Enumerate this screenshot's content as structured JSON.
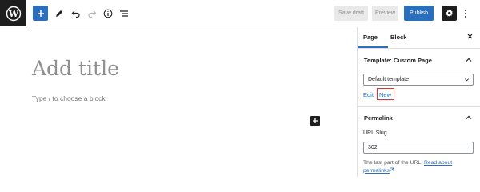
{
  "toolbar": {
    "logo_icon": "wordpress-logo",
    "add_block_icon": "plus-icon",
    "tools_icon": "pencil-icon",
    "undo_icon": "undo-icon",
    "redo_icon": "redo-icon",
    "info_icon": "info-icon",
    "list_view_icon": "list-view-icon",
    "save_draft_label": "Save draft",
    "preview_label": "Preview",
    "publish_label": "Publish",
    "settings_icon": "gear-icon",
    "more_icon": "vertical-ellipsis-icon"
  },
  "editor": {
    "title_placeholder": "Add title",
    "block_placeholder": "Type / to choose a block",
    "inserter_icon": "plus-icon"
  },
  "sidebar": {
    "tabs": [
      "Page",
      "Block"
    ],
    "active_tab": "Page",
    "close_icon": "close-icon",
    "template_panel": {
      "title": "Template: Custom Page",
      "selected_template": "Default template",
      "edit_label": "Edit",
      "new_label": "New"
    },
    "permalink_panel": {
      "title": "Permalink",
      "slug_label": "URL Slug",
      "slug_value": "302",
      "help_text": "The last part of the URL.",
      "help_link": "Read about permalinks",
      "external_icon": "external-link-icon"
    }
  },
  "colors": {
    "accent": "#2a6fbd",
    "dark": "#1e1e1e",
    "highlight_box": "#e0332a"
  }
}
